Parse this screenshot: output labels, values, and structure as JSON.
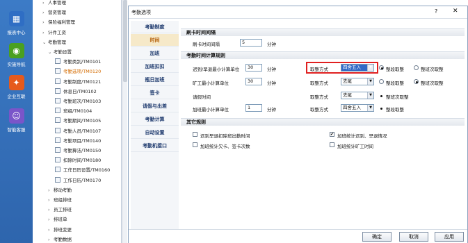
{
  "rail": [
    {
      "label": "报表中心",
      "color": "#2f6ec4",
      "icon": "report-icon"
    },
    {
      "label": "实施导航",
      "color": "#4aa01f",
      "icon": "navigation-icon"
    },
    {
      "label": "企业互联",
      "color": "#e65a1c",
      "icon": "connect-icon"
    },
    {
      "label": "智能客服",
      "color": "#7a55c9",
      "icon": "service-icon"
    }
  ],
  "tree": [
    {
      "label": "人事管理",
      "type": "arrow",
      "level": 1
    },
    {
      "label": "营资管理",
      "type": "arrow",
      "level": 1
    },
    {
      "label": "保险福利管理",
      "type": "arrow",
      "level": 1
    },
    {
      "label": "计件工资",
      "type": "arrow",
      "level": 1
    },
    {
      "label": "考勤管理",
      "type": "open",
      "level": 1
    },
    {
      "label": "考勤设置",
      "type": "open",
      "level": 2
    },
    {
      "label": "考勤类别/TM0101",
      "type": "doc",
      "level": 3
    },
    {
      "label": "考勤选项/TM0120",
      "type": "doc",
      "level": 3,
      "selected": true
    },
    {
      "label": "考勤制度/TM0121",
      "type": "doc",
      "level": 3
    },
    {
      "label": "休息日/TM0102",
      "type": "doc",
      "level": 3
    },
    {
      "label": "考勤班次/TM0103",
      "type": "doc",
      "level": 3
    },
    {
      "label": "班组/TM0104",
      "type": "doc",
      "level": 3
    },
    {
      "label": "考勤期间/TM0105",
      "type": "doc",
      "level": 3
    },
    {
      "label": "考勤人员/TM0107",
      "type": "doc",
      "level": 3
    },
    {
      "label": "考勤项目/TM0140",
      "type": "doc",
      "level": 3
    },
    {
      "label": "考勤算法/TM0150",
      "type": "doc",
      "level": 3
    },
    {
      "label": "扣除时间/TM0180",
      "type": "doc",
      "level": 3
    },
    {
      "label": "工作日历设置/TM0160",
      "type": "doc",
      "level": 3
    },
    {
      "label": "工作日历/TM0170",
      "type": "doc",
      "level": 3
    },
    {
      "label": "移动考勤",
      "type": "arrow",
      "level": 2
    },
    {
      "label": "班组排班",
      "type": "arrow",
      "level": 2
    },
    {
      "label": "员工排班",
      "type": "arrow",
      "level": 2
    },
    {
      "label": "排班单",
      "type": "arrow",
      "level": 2
    },
    {
      "label": "排班变更",
      "type": "arrow",
      "level": 2
    },
    {
      "label": "考勤数据",
      "type": "arrow",
      "level": 2
    }
  ],
  "dialog": {
    "title": "考勤选项",
    "help": "?",
    "close": "✕",
    "tabs": [
      "考勤制度",
      "时间",
      "加班",
      "加班扣扣",
      "瓶日加班",
      "签卡",
      "请假与出差",
      "考勤计算",
      "自动设置",
      "考勤机接口"
    ],
    "active_tab": 1,
    "sections": {
      "card_interval": "刷卡时间间隔",
      "min_unit": "考勤时间计算规则",
      "other": "其它规则"
    },
    "card_interval": {
      "label": "刷卡时间间隔",
      "value": "5",
      "unit": "分钟"
    },
    "rows": [
      {
        "label": "迟到/早退最小计算单位",
        "value": "30",
        "unit": "分钟",
        "round_label": "取整方式",
        "round_value": "四舍五入",
        "radio1": "整段取整",
        "radio2": "整班次取整",
        "r1": true,
        "r2": false,
        "highlight": true
      },
      {
        "label": "旷工最小计算单位",
        "value": "30",
        "unit": "分钟",
        "round_label": "取整方式",
        "round_value": "去尾",
        "radio1": "整段取整",
        "radio2": "整班次取整",
        "r1": false,
        "r2": true,
        "highlight": false
      },
      {
        "label": "请假时间",
        "value": null,
        "unit": null,
        "round_label": "取整方式",
        "round_value": "去尾",
        "radio1": "整班次取整",
        "radio2": null,
        "r1": true,
        "r2": false,
        "highlight": false
      },
      {
        "label": "加班最小计算单位",
        "value": "1",
        "unit": "分钟",
        "round_label": "取整方式",
        "round_value": "四舍五入",
        "radio1": "整段取整",
        "radio2": null,
        "r1": true,
        "r2": false,
        "highlight": false
      }
    ],
    "checkboxes": [
      {
        "label": "迟到早退扣除班出勤时间",
        "checked": false
      },
      {
        "label": "加班统计迟到、早退情况",
        "checked": true
      },
      {
        "label": "加班统计欠卡、签卡次数",
        "checked": false
      },
      {
        "label": "加班统计旷工时间",
        "checked": false
      }
    ],
    "buttons": {
      "ok": "确定",
      "cancel": "取消",
      "apply": "应用"
    }
  }
}
